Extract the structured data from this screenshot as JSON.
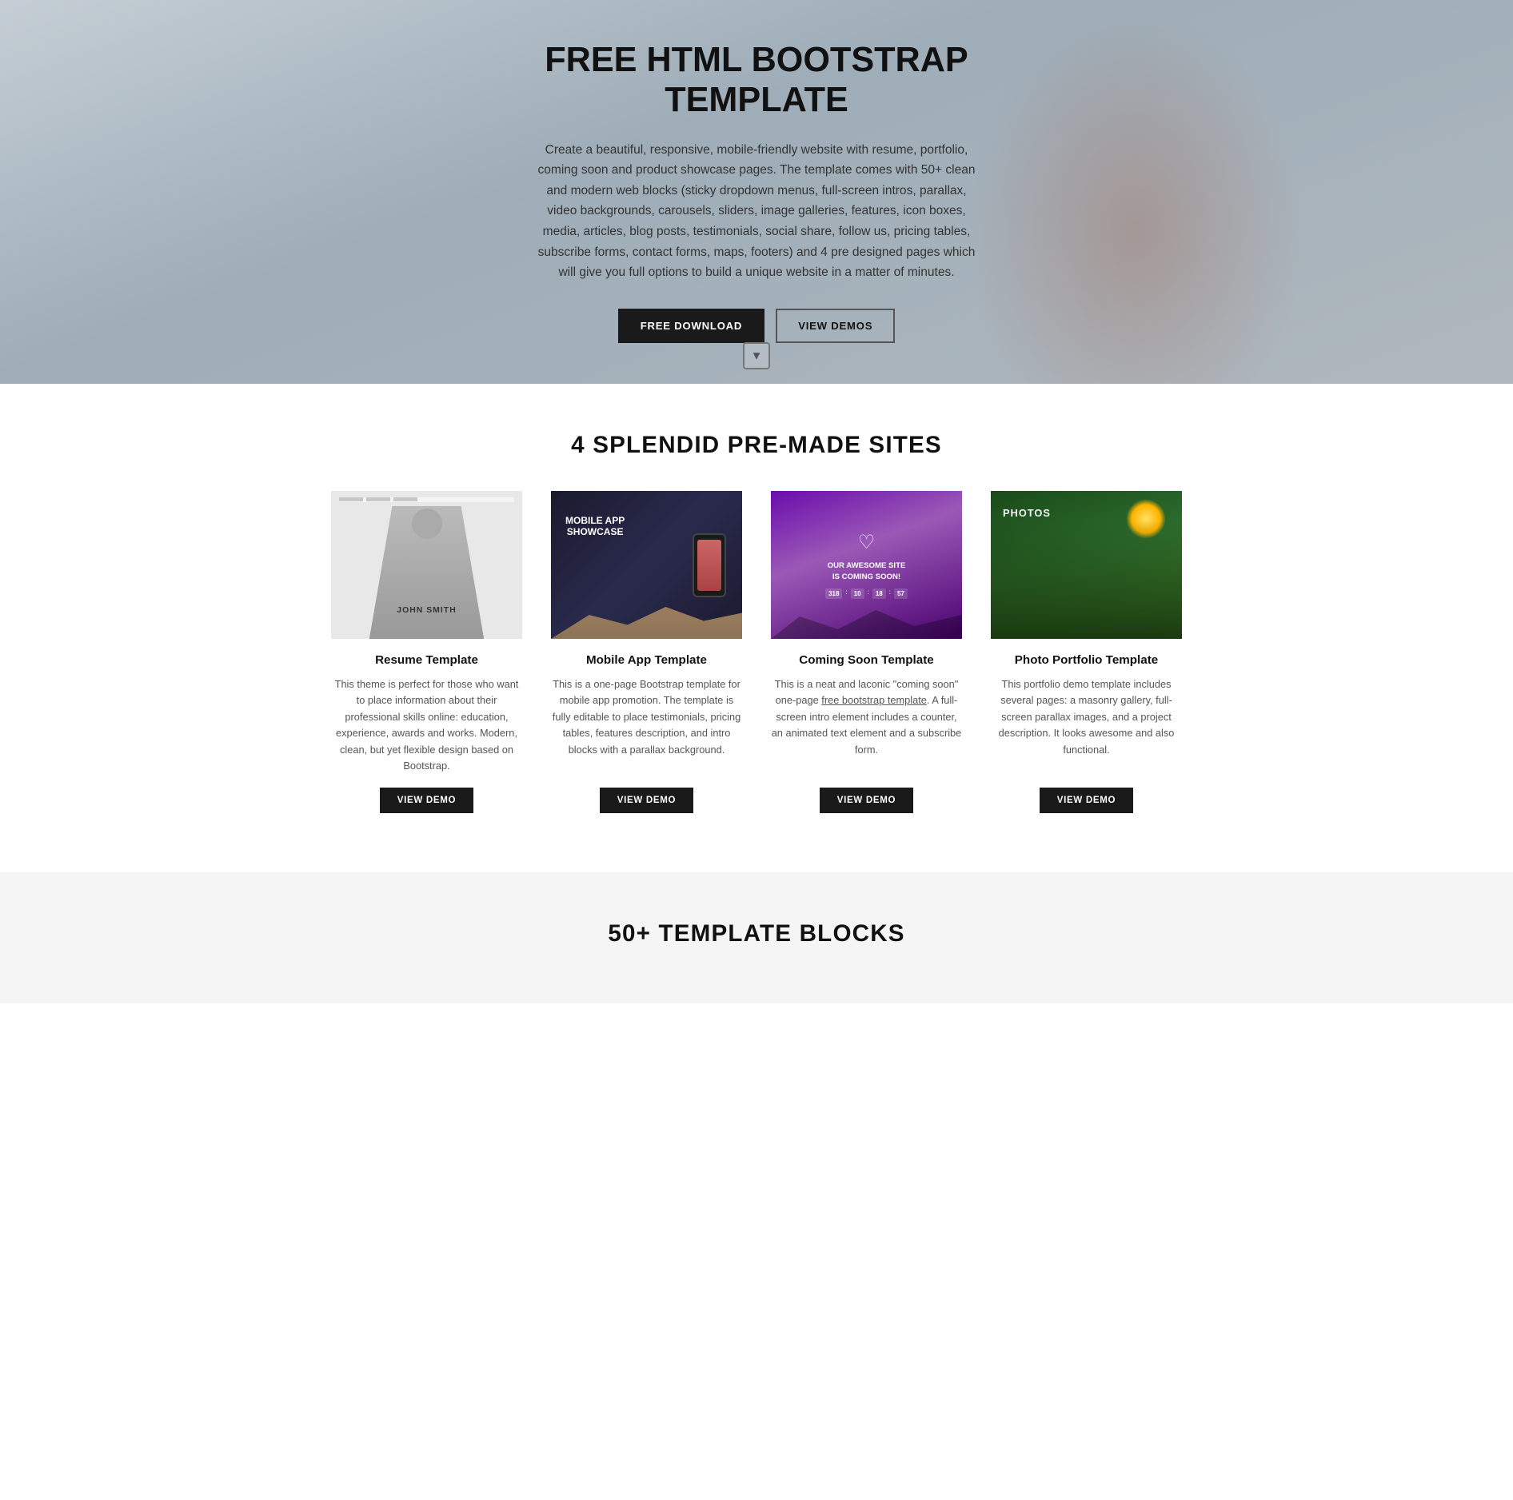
{
  "hero": {
    "title": "FREE HTML BOOTSTRAP TEMPLATE",
    "description": "Create a beautiful, responsive, mobile-friendly website with resume, portfolio, coming soon and product showcase pages. The template comes with 50+ clean and modern web blocks (sticky dropdown menus, full-screen intros, parallax, video backgrounds, carousels, sliders, image galleries, features, icon boxes, media, articles, blog posts, testimonials, social share, follow us, pricing tables, subscribe forms, contact forms, maps, footers) and 4 pre designed pages which will give you full options to build a unique website in a matter of minutes.",
    "btn_download": "FREE DOWNLOAD",
    "btn_demos": "VIEW DEMOS"
  },
  "premade": {
    "section_title": "4 SPLENDID PRE-MADE SITES",
    "cards": [
      {
        "id": "resume",
        "title": "Resume Template",
        "description": "This theme is perfect for those who want to place information about their professional skills online: education, experience, awards and works. Modern, clean, but yet flexible design based on Bootstrap.",
        "btn_label": "VIEW DEMO",
        "person_name": "JOHN SMITH"
      },
      {
        "id": "mobile",
        "title": "Mobile App Template",
        "description": "This is a one-page Bootstrap template for mobile app promotion. The template is fully editable to place testimonials, pricing tables, features description, and intro blocks with a parallax background.",
        "btn_label": "VIEW DEMO",
        "showcase_text": "MOBILE APP SHOWCASE"
      },
      {
        "id": "coming-soon",
        "title": "Coming Soon Template",
        "description": "This is a neat and laconic \"coming soon\" one-page free bootstrap template. A full-screen intro element includes a counter, an animated text element and a subscribe form.",
        "btn_label": "VIEW DEMO",
        "coming_text": "OUR AWESOME SITE IS COMING SOON!",
        "counter": "318 : 10 : 18 : 57"
      },
      {
        "id": "portfolio",
        "title": "Photo Portfolio Template",
        "description": "This portfolio demo template includes several pages: a masonry gallery, full-screen parallax images, and a project description. It looks awesome and also functional.",
        "btn_label": "VIEW DEMO",
        "photos_text": "PHOTOS"
      }
    ]
  },
  "blocks_section": {
    "title": "50+ TEMPLATE BLOCKS"
  }
}
